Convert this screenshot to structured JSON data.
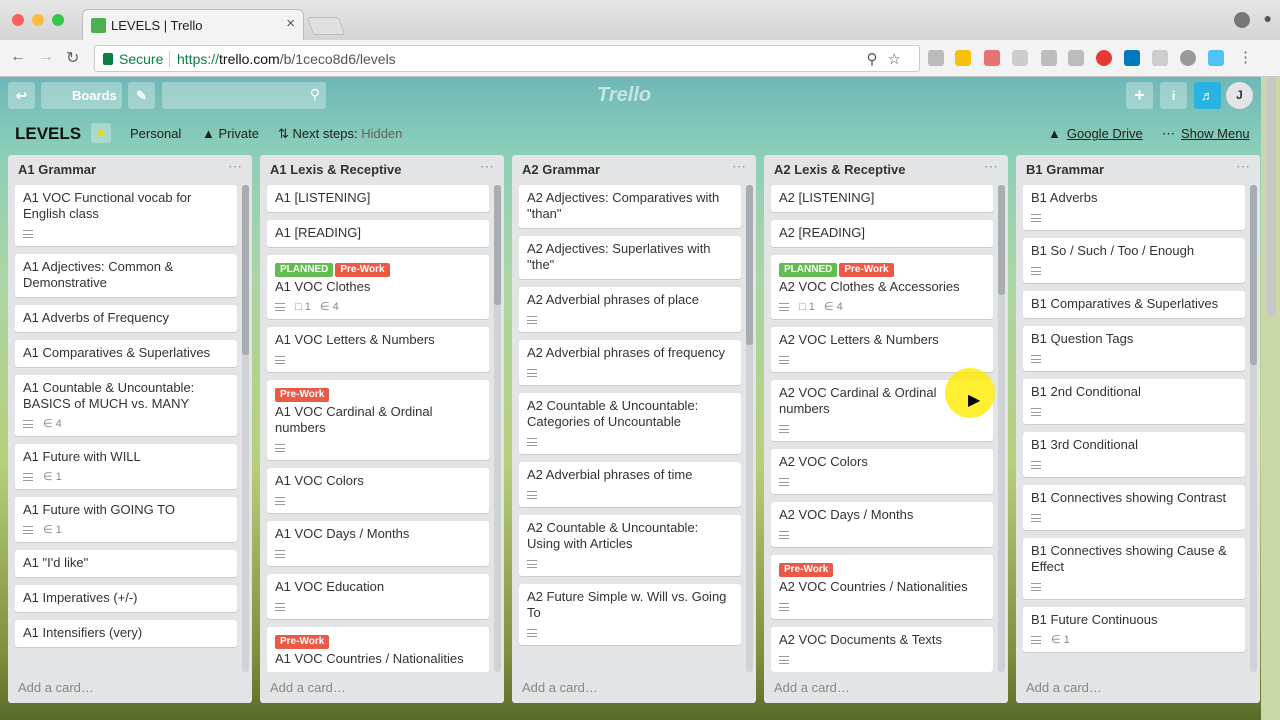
{
  "browser": {
    "tab_title": "LEVELS | Trello",
    "tab_close": "×",
    "secure_label": "Secure",
    "url_scheme": "https://",
    "url_host": "trello.com",
    "url_path": "/b/1ceco8d6/levels"
  },
  "topbar": {
    "boards_label": "Boards",
    "logo": "Trello",
    "avatar_initial": "J"
  },
  "board": {
    "name": "LEVELS",
    "team": "Personal",
    "visibility": "Private",
    "next_steps_label": "Next steps:",
    "next_steps_value": "Hidden",
    "power_up": "Google Drive",
    "show_menu": "Show Menu"
  },
  "colors": {
    "planned": "#61bd4f",
    "prework": "#eb5a46"
  },
  "lists": [
    {
      "title": "A1 Grammar",
      "add": "Add a card…",
      "cards": [
        {
          "text": "A1 VOC Functional vocab for English class",
          "desc": true
        },
        {
          "text": "A1 Adjectives: Common & Demonstrative"
        },
        {
          "text": "A1 Adverbs of Frequency"
        },
        {
          "text": "A1 Comparatives & Superlatives"
        },
        {
          "text": "A1 Countable & Uncountable: BASICS of MUCH vs. MANY",
          "desc": true,
          "attach": "4"
        },
        {
          "text": "A1 Future with WILL",
          "desc": true,
          "attach": "1"
        },
        {
          "text": "A1 Future with GOING TO",
          "desc": true,
          "attach": "1"
        },
        {
          "text": "A1 \"I'd like\""
        },
        {
          "text": "A1 Imperatives (+/-)"
        },
        {
          "text": "A1 Intensifiers (very)"
        }
      ]
    },
    {
      "title": "A1 Lexis & Receptive",
      "add": "Add a card…",
      "cards": [
        {
          "text": "A1 [LISTENING]"
        },
        {
          "text": "A1 [READING]"
        },
        {
          "text": "A1 VOC Clothes",
          "labels": [
            "PLANNED",
            "Pre-Work"
          ],
          "desc": true,
          "comments": "1",
          "attach": "4"
        },
        {
          "text": "A1 VOC Letters & Numbers",
          "desc": true
        },
        {
          "text": "A1 VOC Cardinal & Ordinal numbers",
          "labels": [
            "Pre-Work"
          ],
          "desc": true
        },
        {
          "text": "A1 VOC Colors",
          "desc": true
        },
        {
          "text": "A1 VOC Days / Months",
          "desc": true
        },
        {
          "text": "A1 VOC Education",
          "desc": true
        },
        {
          "text": "A1 VOC Countries / Nationalities",
          "labels": [
            "Pre-Work"
          ]
        }
      ]
    },
    {
      "title": "A2 Grammar",
      "add": "Add a card…",
      "cards": [
        {
          "text": "A2 Adjectives: Comparatives with \"than\""
        },
        {
          "text": "A2 Adjectives: Superlatives with \"the\""
        },
        {
          "text": "A2 Adverbial phrases of place",
          "desc": true
        },
        {
          "text": "A2 Adverbial phrases of frequency",
          "desc": true
        },
        {
          "text": "A2 Countable & Uncountable: Categories of Uncountable",
          "desc": true
        },
        {
          "text": "A2 Adverbial phrases of time",
          "desc": true
        },
        {
          "text": "A2 Countable & Uncountable: Using with Articles",
          "desc": true
        },
        {
          "text": "A2 Future Simple w. Will vs. Going To",
          "desc": true
        }
      ]
    },
    {
      "title": "A2 Lexis & Receptive",
      "add": "Add a card…",
      "cards": [
        {
          "text": "A2 [LISTENING]"
        },
        {
          "text": "A2 [READING]"
        },
        {
          "text": "A2 VOC Clothes & Accessories",
          "labels": [
            "PLANNED",
            "Pre-Work"
          ],
          "desc": true,
          "comments": "1",
          "attach": "4"
        },
        {
          "text": "A2 VOC Letters & Numbers",
          "desc": true
        },
        {
          "text": "A2 VOC Cardinal & Ordinal numbers",
          "desc": true
        },
        {
          "text": "A2 VOC Colors",
          "desc": true
        },
        {
          "text": "A2 VOC Days / Months",
          "desc": true
        },
        {
          "text": "A2 VOC Countries / Nationalities",
          "labels": [
            "Pre-Work"
          ],
          "desc": true
        },
        {
          "text": "A2 VOC Documents & Texts",
          "desc": true
        }
      ]
    },
    {
      "title": "B1 Grammar",
      "add": "Add a card…",
      "cards": [
        {
          "text": "B1 Adverbs",
          "desc": true
        },
        {
          "text": "B1 So / Such / Too / Enough",
          "desc": true
        },
        {
          "text": "B1 Comparatives & Superlatives"
        },
        {
          "text": "B1 Question Tags",
          "desc": true
        },
        {
          "text": "B1 2nd Conditional",
          "desc": true
        },
        {
          "text": "B1 3rd Conditional",
          "desc": true
        },
        {
          "text": "B1 Connectives showing Contrast",
          "desc": true
        },
        {
          "text": "B1 Connectives showing Cause & Effect",
          "desc": true
        },
        {
          "text": "B1 Future Continuous",
          "desc": true,
          "attach": "1"
        }
      ]
    }
  ]
}
